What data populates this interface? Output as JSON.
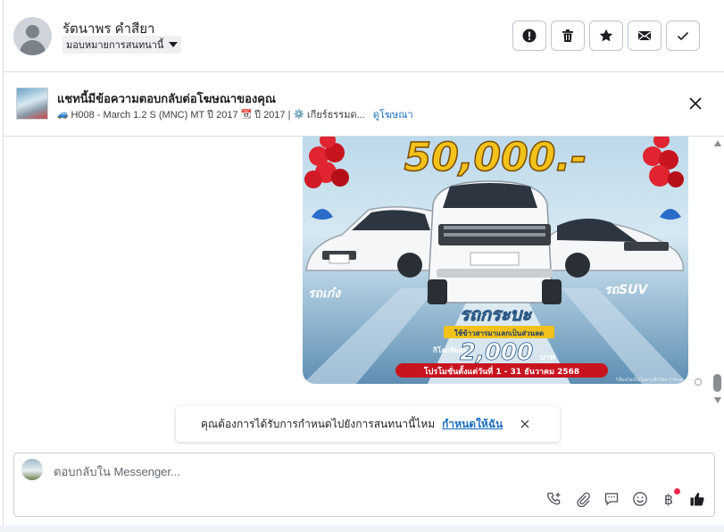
{
  "header": {
    "contact_name": "รัตนาพร คำสียา",
    "assign_label": "มอบหมายการสนทนานี้",
    "actions": [
      {
        "name": "mark-spam-button",
        "icon": "alert-icon"
      },
      {
        "name": "delete-button",
        "icon": "trash-icon"
      },
      {
        "name": "star-button",
        "icon": "star-icon"
      },
      {
        "name": "mark-unread-button",
        "icon": "envelope-icon"
      },
      {
        "name": "mark-done-button",
        "icon": "check-icon"
      }
    ]
  },
  "ad_banner": {
    "title": "แชทนี้มีข้อความตอบกลับต่อโฆษณาของคุณ",
    "car_emoji": "🚙",
    "vehicle": "H008 - March 1.2 S (MNC) MT ปี 2017",
    "calendar_emoji": "📆",
    "year": "ปี 2017 |",
    "gear_emoji": "⚙️",
    "transmission": "เกียร์ธรรมด...",
    "view_ad_link": "ดูโฆษณา"
  },
  "promo_image": {
    "price": "50,000.-",
    "left_label": "รถเก๋ง",
    "right_label": "รถSUV",
    "center_label": "รถกระบะ",
    "trade_in_text": "ใช้ข้าวสารมาแลกเป็นส่วนลด",
    "per_kg_text": "กิโลกรัมละ",
    "kg_price": "2,000",
    "kg_unit": "บาท",
    "promo_period": "โปรโมชั่นตั้งแต่วันที่ 1 - 31 ธันวาคม 2568",
    "fine_print": "*เงื่อนไขเป็นไปตามที่บริษัท กำหนด"
  },
  "assign_toast": {
    "question": "คุณต้องการได้รับการกำหนดไปยังการสนทนานี้ไหม",
    "link": "กำหนดให้ฉัน"
  },
  "composer": {
    "placeholder": "ตอบกลับใน Messenger...",
    "value": "",
    "tools": [
      "call-add-icon",
      "paperclip-icon",
      "saved-reply-icon",
      "emoji-icon",
      "baht-icon",
      "thumbs-up-icon"
    ],
    "baht_symbol": "฿"
  },
  "colors": {
    "link": "#1b6ec2",
    "notification_dot": "#f0284a",
    "border": "#dadde1"
  }
}
